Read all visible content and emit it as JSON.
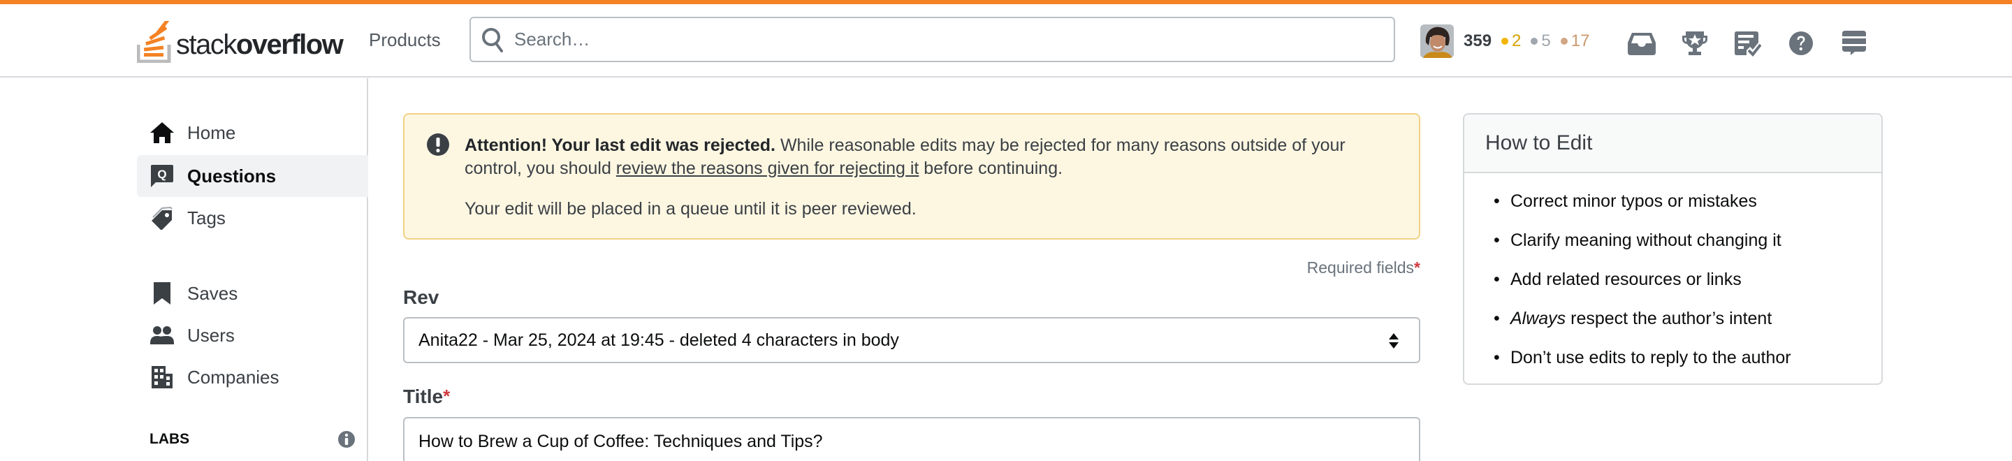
{
  "colors": {
    "accent": "#f48225",
    "alert_bg": "#fdf7e2",
    "alert_border": "#f1d185",
    "required": "#d0393e",
    "gold": "#f1b600",
    "silver": "#9fa6ad",
    "bronze": "#d1a684"
  },
  "header": {
    "logo": {
      "thin": "stack",
      "bold": "overflow"
    },
    "products_label": "Products",
    "search_placeholder": "Search…",
    "user": {
      "reputation": "359",
      "gold_badges": "2",
      "silver_badges": "5",
      "bronze_badges": "17"
    },
    "icons": [
      "inbox-icon",
      "achievements-icon",
      "review-queue-icon",
      "help-icon",
      "site-switcher-icon"
    ]
  },
  "sidebar": {
    "items": [
      {
        "label": "Home",
        "icon": "home-icon",
        "active": false
      },
      {
        "label": "Questions",
        "icon": "questions-icon",
        "active": true
      },
      {
        "label": "Tags",
        "icon": "tag-icon",
        "active": false
      },
      {
        "label": "Saves",
        "icon": "bookmark-icon",
        "active": false
      },
      {
        "label": "Users",
        "icon": "users-icon",
        "active": false
      },
      {
        "label": "Companies",
        "icon": "building-icon",
        "active": false
      }
    ],
    "labs_heading": "LABS"
  },
  "alert": {
    "bold": "Attention! Your last edit was rejected.",
    "text_before_link": " While reasonable edits may be rejected for many reasons outside of your control, you should ",
    "link": "review the reasons given for rejecting it",
    "text_after_link": " before continuing.",
    "subtext": "Your edit will be placed in a queue until it is peer reviewed."
  },
  "form": {
    "required_label": "Required fields",
    "required_marker": "*",
    "rev_label": "Rev",
    "rev_value": "Anita22 - Mar 25, 2024 at 19:45 - deleted 4 characters in body",
    "title_label": "Title",
    "title_marker": "*",
    "title_value": "How to Brew a Cup of Coffee: Techniques and Tips?"
  },
  "how_to_edit": {
    "heading": "How to Edit",
    "items": [
      {
        "em": "",
        "text": "Correct minor typos or mistakes"
      },
      {
        "em": "",
        "text": "Clarify meaning without changing it"
      },
      {
        "em": "",
        "text": "Add related resources or links"
      },
      {
        "em": "Always",
        "text": " respect the author’s intent"
      },
      {
        "em": "",
        "text": "Don’t use edits to reply to the author"
      }
    ]
  }
}
